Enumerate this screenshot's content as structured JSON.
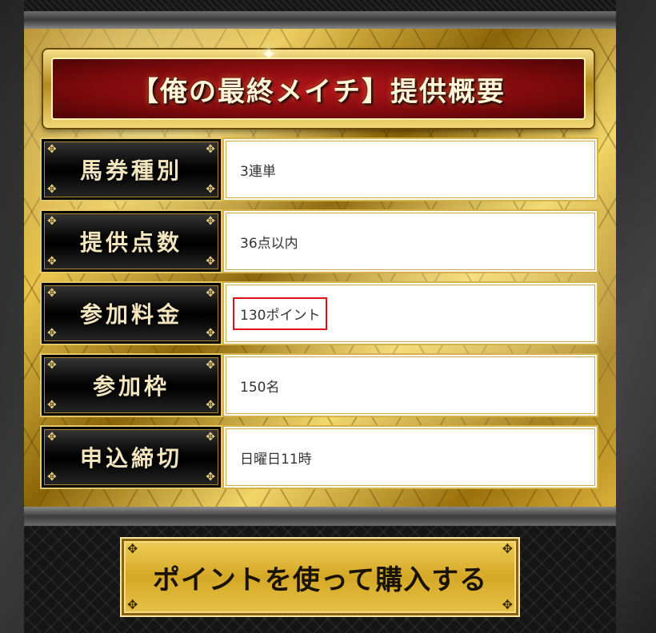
{
  "panel": {
    "title": "【俺の最終メイチ】提供概要",
    "rows": [
      {
        "label": "馬券種別",
        "value": "3連単"
      },
      {
        "label": "提供点数",
        "value": "36点以内"
      },
      {
        "label": "参加料金",
        "value": "130ポイント"
      },
      {
        "label": "参加枠",
        "value": "150名"
      },
      {
        "label": "申込締切",
        "value": "日曜日11時"
      }
    ]
  },
  "purchase": {
    "label": "ポイントを使って購入する"
  },
  "colors": {
    "banner_red": "#8b0b0f",
    "gold": "#d5a827",
    "highlight_border": "#e0101a"
  },
  "icons": {
    "ornament": "✥",
    "sparkle": "✦"
  }
}
